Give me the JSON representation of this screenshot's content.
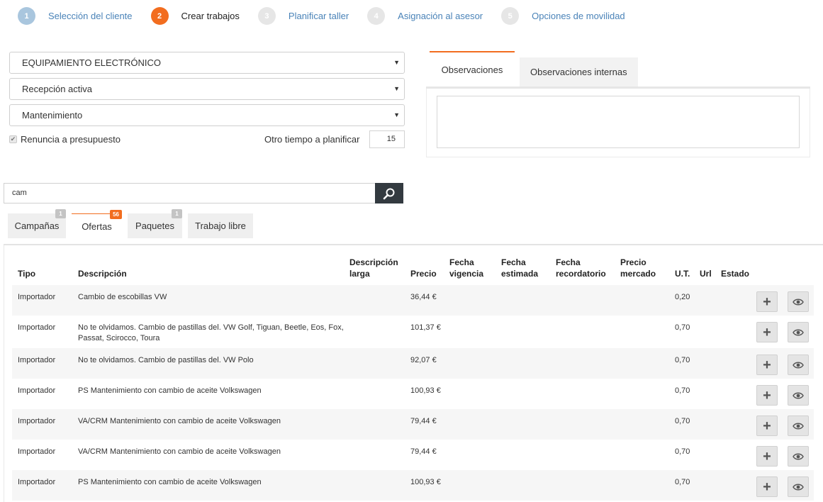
{
  "steps": [
    {
      "num": "1",
      "label": "Selección del cliente",
      "state": "done"
    },
    {
      "num": "2",
      "label": "Crear trabajos",
      "state": "active"
    },
    {
      "num": "3",
      "label": "Planificar taller",
      "state": "pending"
    },
    {
      "num": "4",
      "label": "Asignación al asesor",
      "state": "pending"
    },
    {
      "num": "5",
      "label": "Opciones de movilidad",
      "state": "pending"
    }
  ],
  "selects": {
    "equipment": "EQUIPAMIENTO ELECTRÓNICO",
    "reception": "Recepción activa",
    "service": "Mantenimiento"
  },
  "renuncia_label": "Renuncia a presupuesto",
  "renuncia_checked": true,
  "otro_tiempo": {
    "label": "Otro tiempo a planificar",
    "value": "15"
  },
  "observations": {
    "tab_active": "Observaciones",
    "tab_internal": "Observaciones internas",
    "text": ""
  },
  "search": {
    "value": "cam"
  },
  "offer_tabs": [
    {
      "label": "Campañas",
      "badge": "1"
    },
    {
      "label": "Ofertas",
      "badge": "56"
    },
    {
      "label": "Paquetes",
      "badge": "1"
    },
    {
      "label": "Trabajo libre",
      "badge": ""
    }
  ],
  "table": {
    "headers": {
      "tipo": "Tipo",
      "descripcion": "Descripción",
      "descripcion_larga_1": "Descripción",
      "descripcion_larga_2": "larga",
      "precio": "Precio",
      "fecha_vigencia_1": "Fecha",
      "fecha_vigencia_2": "vigencia",
      "fecha_estimada_1": "Fecha",
      "fecha_estimada_2": "estimada",
      "fecha_recordatorio_1": "Fecha",
      "fecha_recordatorio_2": "recordatorio",
      "precio_mercado_1": "Precio",
      "precio_mercado_2": "mercado",
      "ut": "U.T.",
      "url": "Url",
      "estado": "Estado"
    },
    "rows": [
      {
        "tipo": "Importador",
        "desc1": "Cambio de escobillas VW",
        "desc2": "",
        "precio": "36,44 €",
        "ut": "0,20"
      },
      {
        "tipo": "Importador",
        "desc1": "No te olvidamos. Cambio de pastillas del. VW Golf, Tiguan, Beetle, Eos, Fox,",
        "desc2": "Passat, Scirocco, Toura",
        "precio": "101,37 €",
        "ut": "0,70"
      },
      {
        "tipo": "Importador",
        "desc1": "No te olvidamos. Cambio de pastillas del. VW Polo",
        "desc2": "",
        "precio": "92,07 €",
        "ut": "0,70"
      },
      {
        "tipo": "Importador",
        "desc1": "PS Mantenimiento con cambio de aceite Volkswagen",
        "desc2": "",
        "precio": "100,93 €",
        "ut": "0,70"
      },
      {
        "tipo": "Importador",
        "desc1": "VA/CRM Mantenimiento con cambio de aceite Volkswagen",
        "desc2": "",
        "precio": "79,44 €",
        "ut": "0,70"
      },
      {
        "tipo": "Importador",
        "desc1": "VA/CRM Mantenimiento con cambio de aceite Volkswagen",
        "desc2": "",
        "precio": "79,44 €",
        "ut": "0,70"
      },
      {
        "tipo": "Importador",
        "desc1": "PS Mantenimiento con cambio de aceite Volkswagen",
        "desc2": "",
        "precio": "100,93 €",
        "ut": "0,70"
      }
    ],
    "add_icon": "plus-icon",
    "view_icon": "eye-icon"
  }
}
